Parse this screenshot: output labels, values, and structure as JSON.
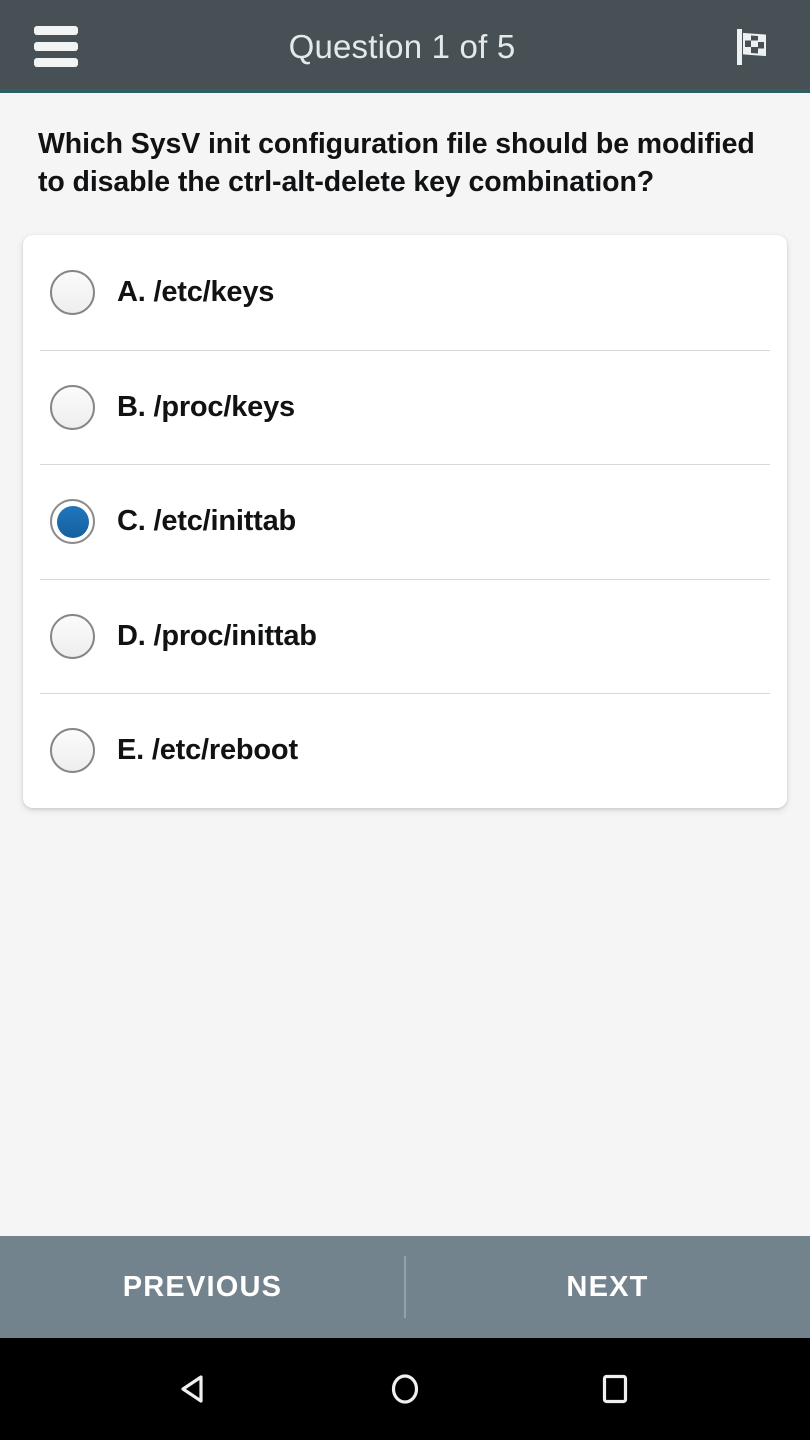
{
  "appbar": {
    "title": "Question 1 of 5",
    "menu_icon": "hamburger-menu-icon",
    "finish_icon": "checkered-flag-icon",
    "background_color": "#475155",
    "accent_line_color": "#2E6063",
    "title_color": "#E6E9E9"
  },
  "question": {
    "text": "Which SysV init configuration file should be modified to disable the ctrl-alt-delete key combination?"
  },
  "options": [
    {
      "label": "A. /etc/keys",
      "letter": "A",
      "value": "/etc/keys",
      "selected": false
    },
    {
      "label": "B. /proc/keys",
      "letter": "B",
      "value": "/proc/keys",
      "selected": false
    },
    {
      "label": "C. /etc/inittab",
      "letter": "C",
      "value": "/etc/inittab",
      "selected": true
    },
    {
      "label": "D. /proc/inittab",
      "letter": "D",
      "value": "/proc/inittab",
      "selected": false
    },
    {
      "label": "E. /etc/reboot",
      "letter": "E",
      "value": "/etc/reboot",
      "selected": false
    }
  ],
  "selected_answer": "C",
  "bottombar": {
    "previous_label": "PREVIOUS",
    "next_label": "NEXT",
    "background_color": "#73838E",
    "text_color": "#FFFFFF"
  },
  "system_nav": {
    "back_icon": "back-triangle-icon",
    "home_icon": "home-circle-icon",
    "recents_icon": "recents-square-icon",
    "background_color": "#000000"
  },
  "theme": {
    "page_background": "#F5F5F5",
    "card_background": "#FFFFFF",
    "radio_selected_color": "#1A6BB0",
    "radio_ring_color": "#868686",
    "divider_color": "#D8D8D8",
    "text_color": "#111214"
  }
}
